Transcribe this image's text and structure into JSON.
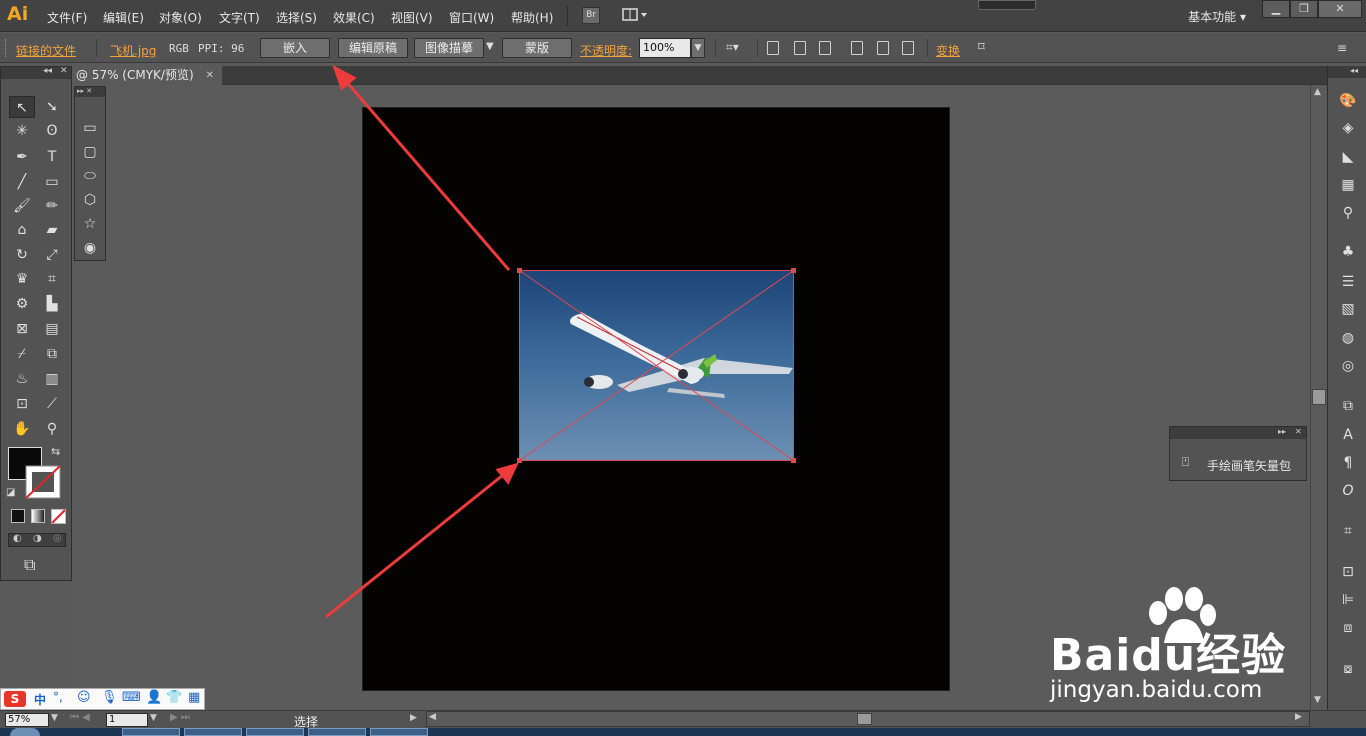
{
  "app": {
    "logo": "Ai"
  },
  "menu": [
    "文件(F)",
    "编辑(E)",
    "对象(O)",
    "文字(T)",
    "选择(S)",
    "效果(C)",
    "视图(V)",
    "窗口(W)",
    "帮助(H)"
  ],
  "menu_extra": {
    "bridge": "Br"
  },
  "workspace": "基本功能",
  "control": {
    "linked_file": "链接的文件",
    "filename": "飞机.jpg",
    "color_mode": "RGB",
    "ppi": "PPI: 96",
    "embed": "嵌入",
    "edit_original": "编辑原稿",
    "image_trace": "图像描摹",
    "mask": "蒙版",
    "opacity_label": "不透明度:",
    "opacity_value": "100%",
    "transform": "变换"
  },
  "document": {
    "tab_title": "@ 57% (CMYK/预览)"
  },
  "panels": {
    "brush_item": "手绘画笔矢量包"
  },
  "status": {
    "zoom": "57%",
    "page": "1",
    "tool": "选择"
  },
  "watermark": {
    "brand": "Baidu经验",
    "url": "jingyan.baidu.com"
  },
  "colors": {
    "accent": "#f3a33a",
    "selection": "#e0484f",
    "arrow": "#ee3b3b",
    "artboard": "#050202"
  }
}
